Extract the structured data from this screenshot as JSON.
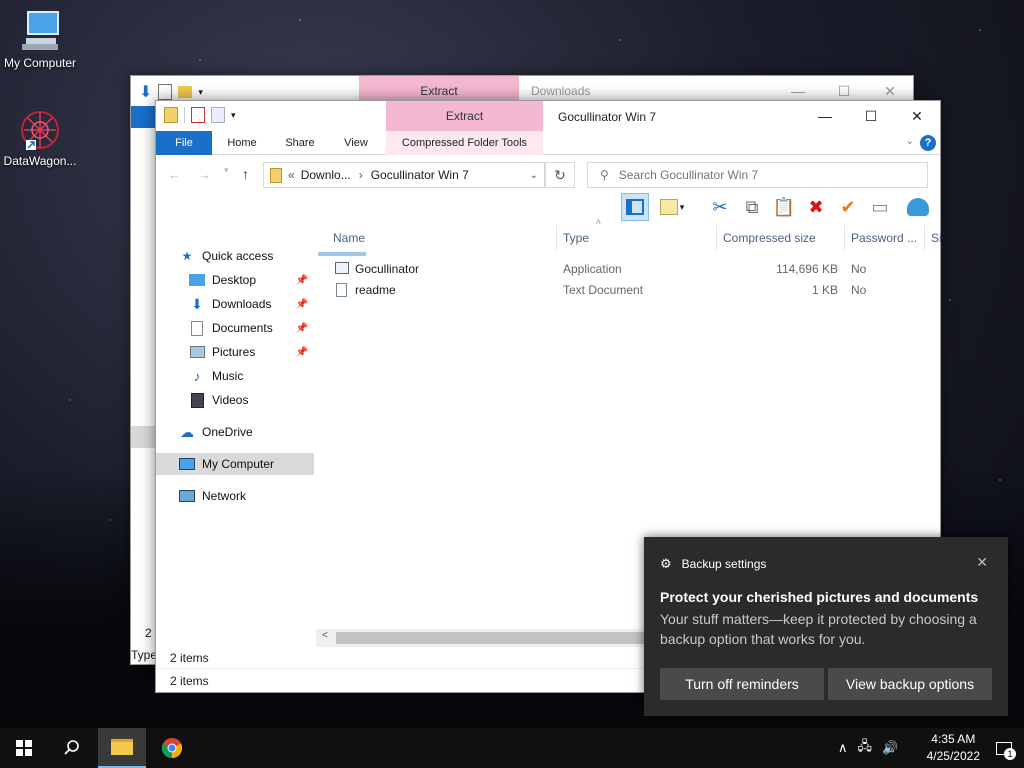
{
  "desktop": {
    "icons": [
      {
        "label": "My Computer"
      },
      {
        "label": "DataWagon..."
      }
    ]
  },
  "back_window": {
    "context_tab": "Extract",
    "title": "Downloads",
    "status_left": "2 i",
    "status_bottom": "Type"
  },
  "front_window": {
    "context_tab": "Extract",
    "title": "Gocullinator Win 7",
    "ribbon_tabs": [
      "File",
      "Home",
      "Share",
      "View",
      "Compressed Folder Tools"
    ],
    "address": {
      "prefix": "«",
      "crumbs": [
        "Downlo...",
        "Gocullinator Win 7"
      ]
    },
    "search_placeholder": "Search Gocullinator Win 7",
    "nav": {
      "quick_access": "Quick access",
      "items": [
        {
          "label": "Desktop",
          "icon": "desktop-icon",
          "pinned": true
        },
        {
          "label": "Downloads",
          "icon": "downloads-icon",
          "pinned": true
        },
        {
          "label": "Documents",
          "icon": "documents-icon",
          "pinned": true
        },
        {
          "label": "Pictures",
          "icon": "pictures-icon",
          "pinned": true
        },
        {
          "label": "Music",
          "icon": "music-icon",
          "pinned": false
        },
        {
          "label": "Videos",
          "icon": "videos-icon",
          "pinned": false
        }
      ],
      "onedrive": "OneDrive",
      "my_computer": "My Computer",
      "network": "Network"
    },
    "columns": [
      "Name",
      "Type",
      "Compressed size",
      "Password ...",
      "Si"
    ],
    "files": [
      {
        "name": "Gocullinator",
        "type": "Application",
        "size": "114,696 KB",
        "password": "No"
      },
      {
        "name": "readme",
        "type": "Text Document",
        "size": "1 KB",
        "password": "No"
      }
    ],
    "inner_status": "2 items",
    "status": "2 items"
  },
  "toast": {
    "app": "Backup settings",
    "title": "Protect your cherished pictures and documents",
    "body": "Your stuff matters—keep it protected by choosing a backup option that works for you.",
    "button_off": "Turn off reminders",
    "button_view": "View backup options"
  },
  "taskbar": {
    "time": "4:35 AM",
    "date": "4/25/2022",
    "notification_count": "1"
  },
  "colors": {
    "accent": "#1a6fc9",
    "context_tab": "#f4b9d0",
    "toast_bg": "#2b2b2b",
    "taskbar_bg": "#101010"
  }
}
